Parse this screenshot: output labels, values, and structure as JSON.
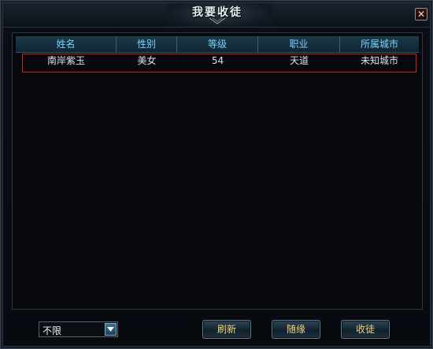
{
  "window": {
    "title": "我要收徒",
    "close_symbol": "✕"
  },
  "table": {
    "headers": [
      "姓名",
      "性别",
      "等级",
      "职业",
      "所属城市"
    ],
    "rows": [
      [
        "南岸紫玉",
        "美女",
        "54",
        "天道",
        "未知城市"
      ]
    ],
    "selected_row": 0
  },
  "filter": {
    "selected": "不限"
  },
  "buttons": {
    "refresh": "刷新",
    "random": "随缘",
    "recruit": "收徒"
  },
  "colors": {
    "header_text": "#7ad3ff",
    "button_text": "#f4d27a",
    "selection_border": "#c62820"
  },
  "icons": {
    "close": "close-icon",
    "dropdown": "chevron-down-icon"
  }
}
